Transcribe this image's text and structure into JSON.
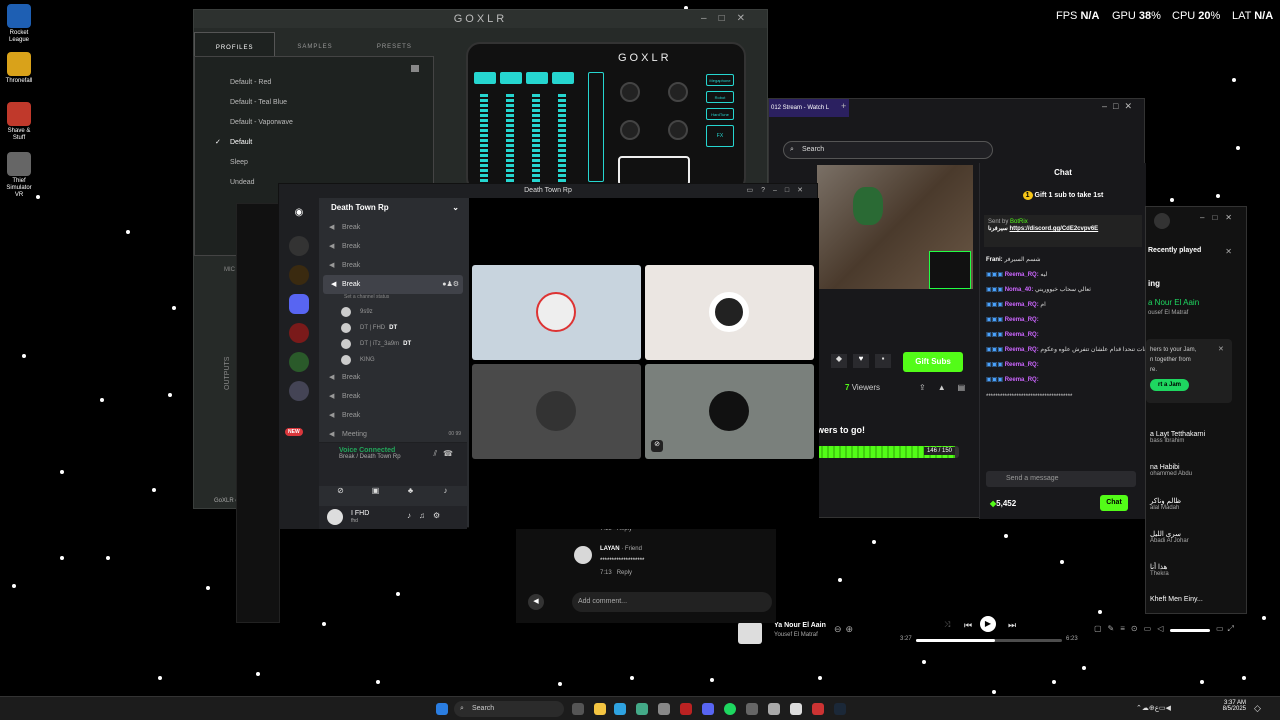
{
  "desktop": {
    "icons": [
      "Rocket League",
      "Thronefall",
      "Shave & Stuff",
      "Thief Simulator VR"
    ]
  },
  "overlay": {
    "fps_label": "FPS",
    "fps_value": "N/A",
    "gpu_label": "GPU",
    "gpu_value": "38",
    "cpu_label": "CPU",
    "cpu_value": "20",
    "lat_label": "LAT",
    "lat_value": "N/A",
    "percent": "%"
  },
  "goxlr": {
    "title": "GOXLR",
    "device_logo": "GOXLR",
    "tabs": [
      "PROFILES",
      "SAMPLES",
      "PRESETS"
    ],
    "profiles": [
      "Default - Red",
      "Default - Teal Blue",
      "Default - Vaporwave",
      "Default",
      "Sleep",
      "Undead"
    ],
    "selected_profile": "Default",
    "side_labels": [
      "MIC",
      "OUTPUTS"
    ],
    "bottom_label": "GoXLR co",
    "device_buttons": [
      "Megaphone",
      "Robot",
      "HardTune",
      "FX"
    ]
  },
  "stream": {
    "tab_title": "012 Stream - Watch L",
    "search_placeholder": "Search",
    "chat_title": "Chat",
    "gift_banner": "Gift 1 sub to take 1st",
    "sent_by": "Sent by",
    "bot_name": "BotRix",
    "bot_message_link": "https://discord.gg/CdE2cvpv6E",
    "bot_message_prefix": "سيرفرنا",
    "messages": [
      {
        "user": "Frani:",
        "text": "شسم السيرفر"
      },
      {
        "user": "Reema_RQ:",
        "text": "ليه"
      },
      {
        "user": "Noma_40:",
        "text": "ثعالي سحاب خيووريني"
      },
      {
        "user": "Reema_RQ:",
        "text": "ام"
      },
      {
        "user": "Reema_RQ:",
        "text": ""
      },
      {
        "user": "Reema_RQ:",
        "text": ""
      },
      {
        "user": "Reema_RQ:",
        "text": "اربع ساعات تنحدا قدام علشان تتفرش علوه وعكوم"
      },
      {
        "user": "Reema_RQ:",
        "text": ""
      },
      {
        "user": "Reema_RQ:",
        "text": ""
      }
    ],
    "spam_line": "*************************************",
    "send_placeholder": "Send a message",
    "points": "5,452",
    "chat_button": "Chat",
    "viewers": "7",
    "viewers_label": "Viewers",
    "gift_subs": "Gift Subs",
    "goal_text": "wers to go!",
    "goal_progress": "146 / 150",
    "goal_fraction": 0.973
  },
  "spotify": {
    "recently_played": "Recently played",
    "now_playing_partial": "ing",
    "np_title": "a Nour El Aain",
    "np_artist": "ousef El Matraf",
    "jam_text1": "hers to your Jam,",
    "jam_text2": "n together from",
    "jam_text3": "re.",
    "jam_button": "rt a Jam",
    "queue": [
      {
        "title": "a Layt Tetthakarni",
        "artist": "bass Ibrahim"
      },
      {
        "title": "na Habibi",
        "artist": "ohammed Abdu"
      },
      {
        "title": "ظالم وناكر",
        "artist": "alal Madah"
      },
      {
        "title": "سرى الليل",
        "artist": "Abadi Al Johar"
      },
      {
        "title": "هذا أنا",
        "artist": "Thekra"
      },
      {
        "title": "Kheft Men Einy...",
        "artist": ""
      }
    ],
    "player_title": "Ya Nour El Aain",
    "player_artist": "Yousef El Matraf",
    "time_elapsed": "3:27",
    "time_total": "6:23",
    "progress": 0.54
  },
  "comments": {
    "reply1_time": "7:13",
    "reply_label": "Reply",
    "author": "LAYAN",
    "author_suffix": "· Friend",
    "comment_text": "*******************",
    "reply2_time": "7:13",
    "add_comment": "Add comment..."
  },
  "discord": {
    "window_title": "Death Town Rp",
    "server_name": "Death Town Rp",
    "channels_top": [
      "Break",
      "Break",
      "Break"
    ],
    "selected_channel": "Break",
    "channel_status": "Set a channel status",
    "voice_users": [
      "9s9z",
      "DT | FHD",
      "DT | iTz_3a9m",
      "KING"
    ],
    "dt_tag": "DT",
    "channels_bottom": [
      "Break",
      "Break",
      "Break",
      "Meeting"
    ],
    "meeting_count_a": "00",
    "meeting_count_b": "99",
    "new_badge": "NEW",
    "voice_connected": "Voice Connected",
    "voice_location": "Break / Death Town Rp",
    "username": "I FHD",
    "user_sub": "fhd",
    "colors": {
      "green": "#23a55a",
      "blurple": "#5865f2",
      "red": "#da373c"
    }
  },
  "taskbar": {
    "search_placeholder": "Search",
    "time": "3:37 AM",
    "date": "8/5/2025"
  }
}
